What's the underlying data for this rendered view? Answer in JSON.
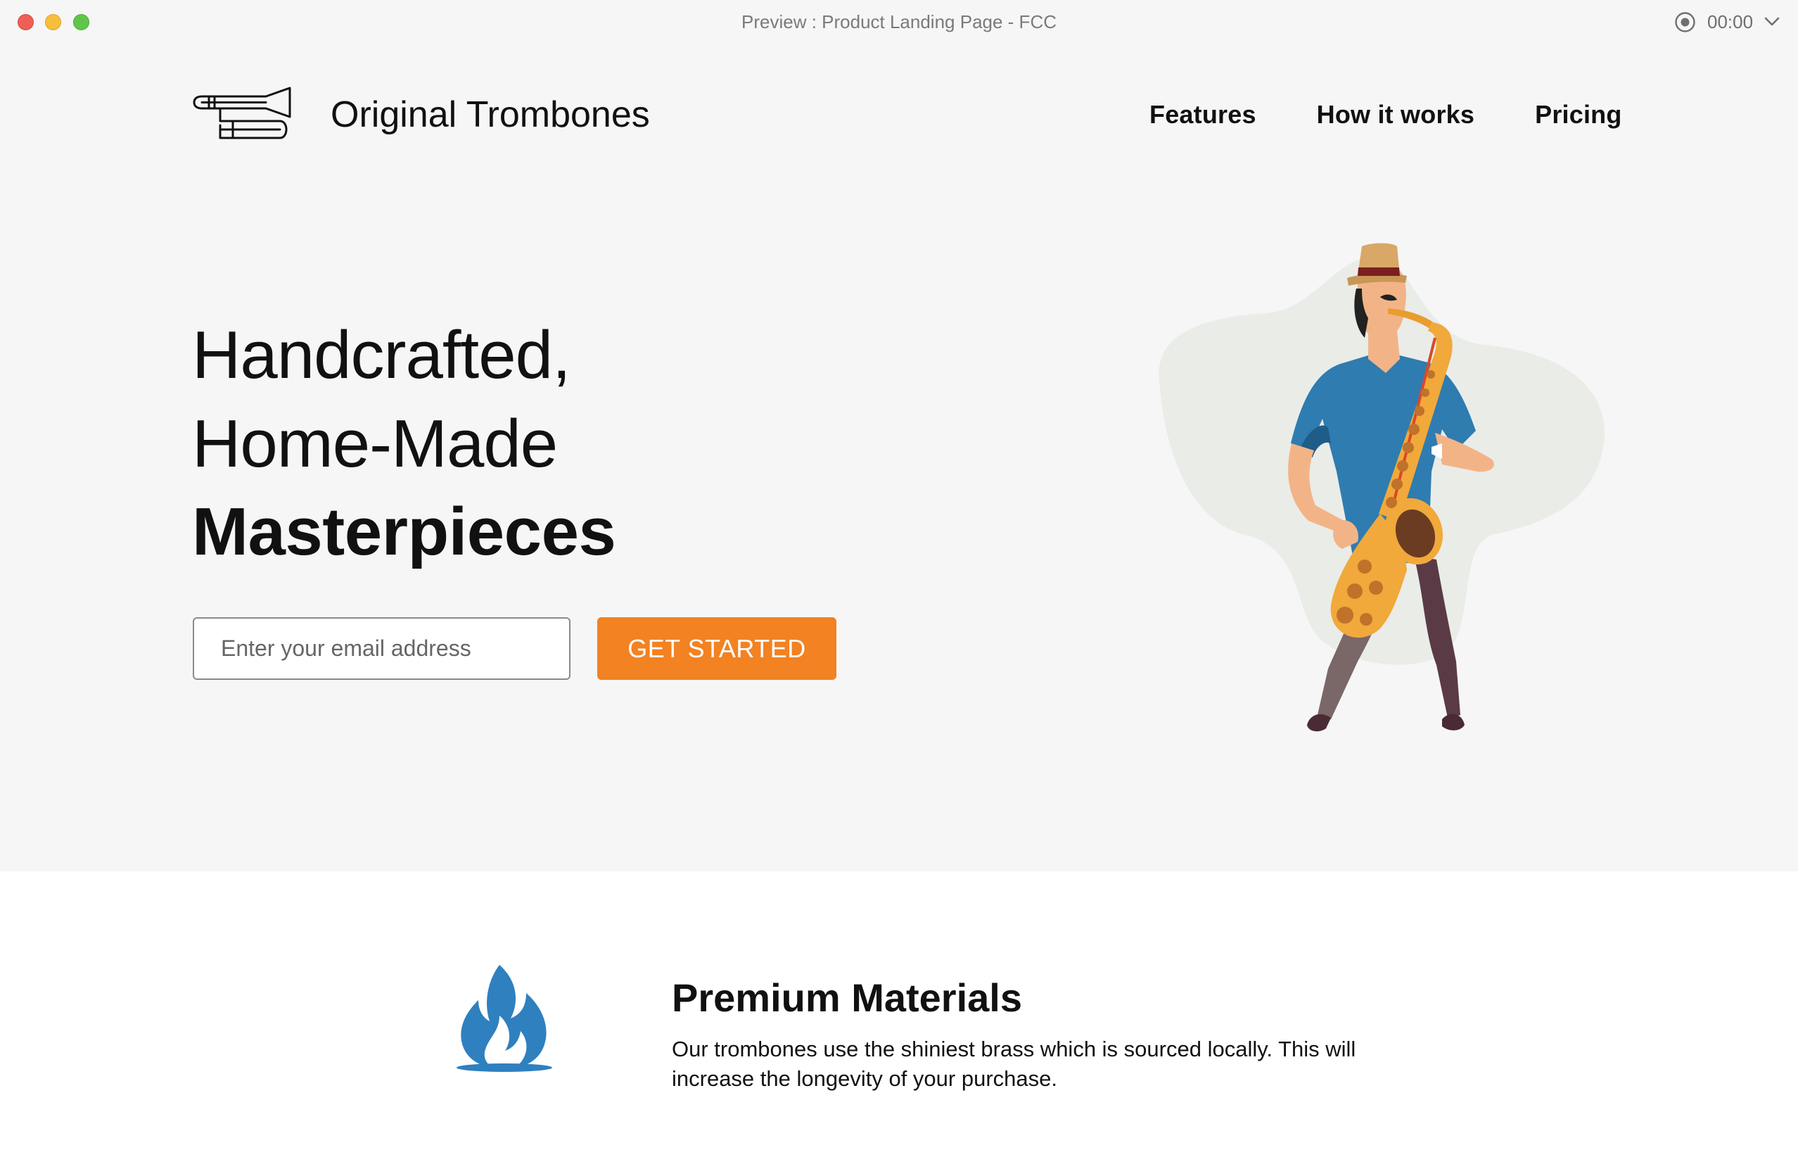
{
  "window": {
    "title": "Preview : Product Landing Page - FCC",
    "timer": "00:00"
  },
  "header": {
    "brand": "Original Trombones",
    "nav": [
      "Features",
      "How it works",
      "Pricing"
    ]
  },
  "hero": {
    "line1": "Handcrafted,",
    "line2": "Home-Made",
    "line3": "Masterpieces",
    "email_placeholder": "Enter your email address",
    "cta_label": "GET STARTED"
  },
  "features": [
    {
      "icon": "fire-icon",
      "title": "Premium Materials",
      "text": "Our trombones use the shiniest brass which is sourced locally. This will increase the longevity of your purchase."
    }
  ],
  "colors": {
    "accent": "#f28222",
    "feature_icon": "#2f80bf",
    "page_bg": "#f6f6f6"
  }
}
